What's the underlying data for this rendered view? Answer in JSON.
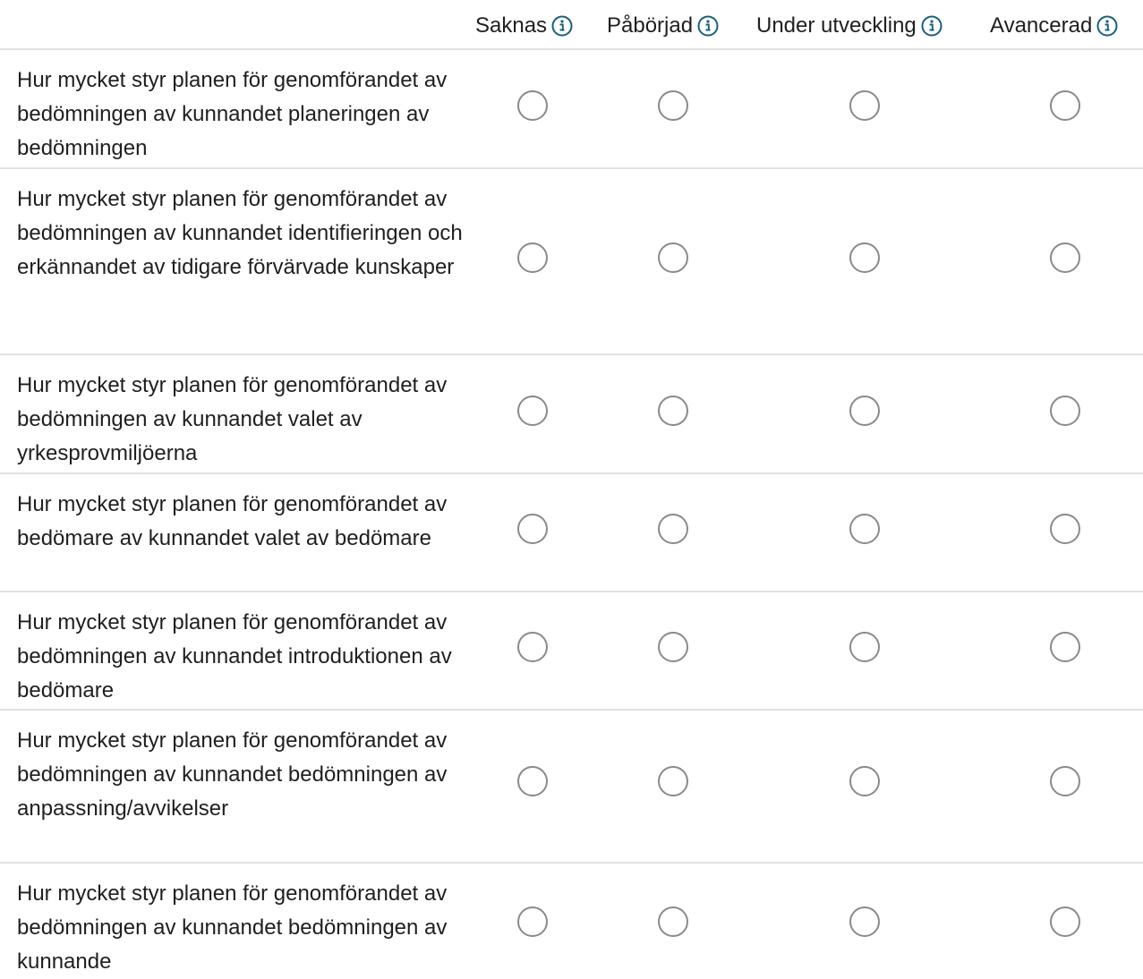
{
  "columns": [
    {
      "label": "Saknas",
      "icon": "info-icon"
    },
    {
      "label": "Påbörjad",
      "icon": "info-icon"
    },
    {
      "label": "Under utveckling",
      "icon": "info-icon"
    },
    {
      "label": "Avancerad",
      "icon": "info-icon"
    }
  ],
  "rows": [
    {
      "question": "Hur mycket styr planen för genomförandet av bedömningen av kunnandet planeringen av bedömningen"
    },
    {
      "question": "Hur mycket styr planen för genomförandet av bedömningen av kunnandet identifieringen och erkännandet av tidigare förvärvade kunskaper"
    },
    {
      "question": "Hur mycket styr planen för genomförandet av bedömningen av kunnandet valet av yrkesprovmiljöerna"
    },
    {
      "question": "Hur mycket styr planen för genomförandet av bedömare av kunnandet valet av bedömare"
    },
    {
      "question": "Hur mycket styr planen för genomförandet av bedömningen av kunnandet introduktionen av bedömare"
    },
    {
      "question": "Hur mycket styr planen för genomförandet av bedömningen av kunnandet bedömningen av anpassning/avvikelser"
    },
    {
      "question": "Hur mycket styr planen för genomförandet av bedömningen av kunnandet bedömningen av kunnande"
    }
  ],
  "colors": {
    "icon_accent": "#17607a",
    "divider": "#e2e2e2",
    "radio_border": "#8a8a8a"
  }
}
